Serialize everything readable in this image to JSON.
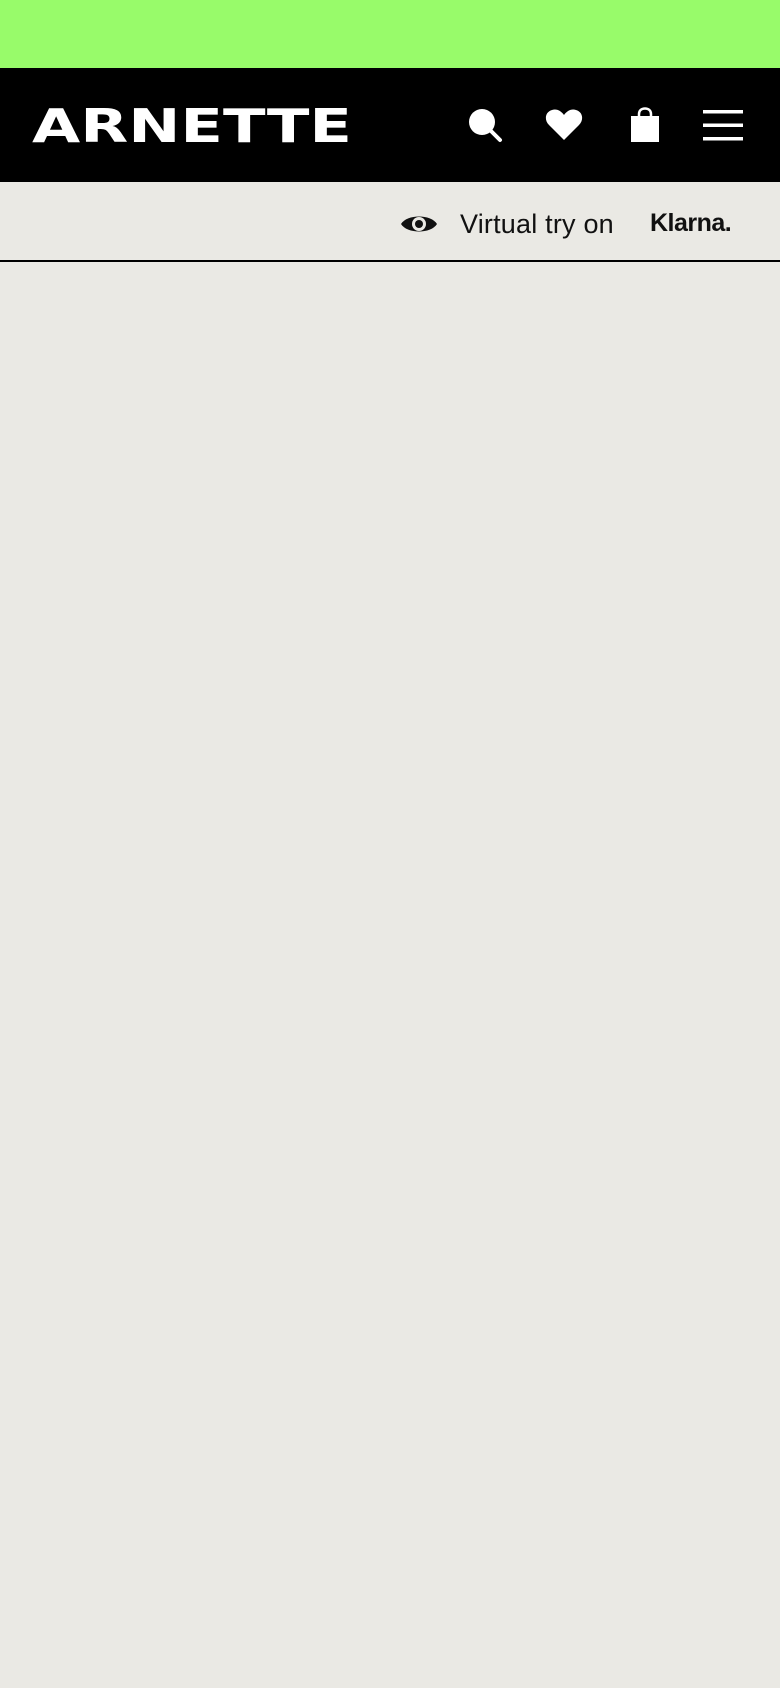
{
  "promo_bar": {
    "color": "#98fb6a"
  },
  "header": {
    "logo_text": "ARNETTE",
    "background": "#000000",
    "icons": [
      "search-icon",
      "heart-icon",
      "shopping-bag-icon",
      "hamburger-menu-icon"
    ]
  },
  "subbar": {
    "virtual_try_on_label": "Virtual try on",
    "virtual_try_on_icon": "eye-icon",
    "klarna_label": "Klarna."
  },
  "colors": {
    "accent": "#98fb6a",
    "header_bg": "#000000",
    "page_bg": "#eae9e4",
    "text": "#111111"
  }
}
